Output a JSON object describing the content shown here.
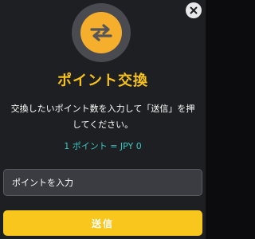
{
  "dialog": {
    "icon": "exchange-arrows-icon",
    "close_icon": "close-icon",
    "title": "ポイント交換",
    "description": "交換したいポイント数を入力して「送信」を押してください。",
    "rate_text": "1 ポイント = JPY 0",
    "input": {
      "placeholder": "ポイントを入力",
      "value": ""
    },
    "submit_label": "送信"
  },
  "colors": {
    "background": "#1e1f22",
    "accent_yellow": "#f8c21c",
    "icon_orange": "#f6ae2d",
    "rate_teal": "#3cc6c1",
    "input_bg": "#3b3c41"
  }
}
